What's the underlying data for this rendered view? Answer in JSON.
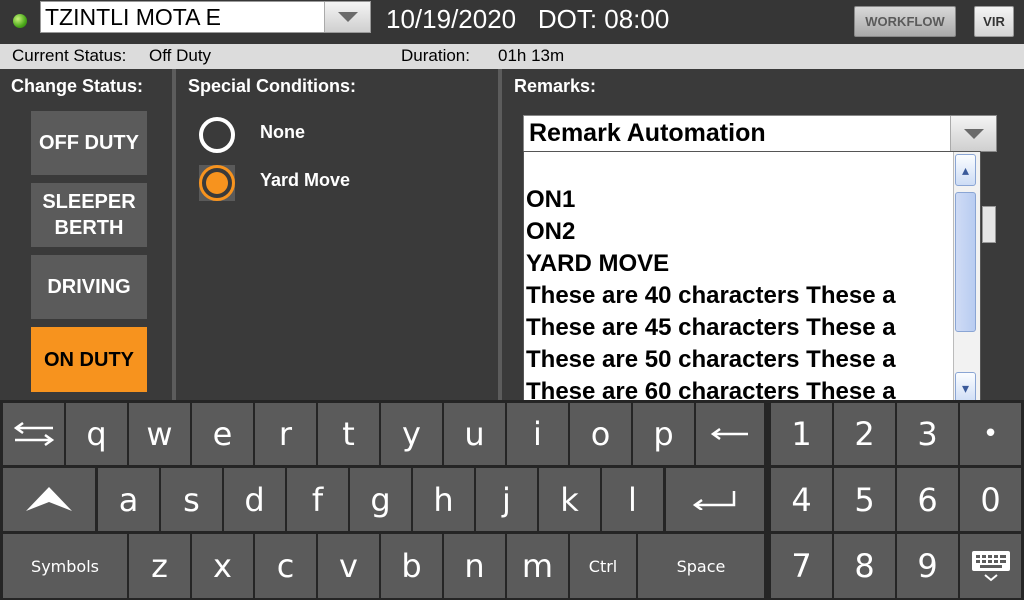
{
  "header": {
    "driver_name": "TZINTLI MOTA E",
    "date": "10/19/2020",
    "dot_label": "DOT: 08:00",
    "workflow_label": "WORKFLOW",
    "vir_label": "VIR",
    "led_color": "#4aa81a"
  },
  "status_bar": {
    "current_status_label": "Current Status:",
    "current_status_value": "Off Duty",
    "duration_label": "Duration:",
    "duration_value": "01h 13m"
  },
  "change_status": {
    "title": "Change Status:",
    "buttons": {
      "off_duty": "OFF DUTY",
      "sleeper_line1": "SLEEPER",
      "sleeper_line2": "BERTH",
      "driving": "DRIVING",
      "on_duty": "ON DUTY"
    },
    "active": "ON DUTY",
    "active_color": "#f7931e"
  },
  "special_conditions": {
    "title": "Special Conditions:",
    "options": [
      "None",
      "Yard Move"
    ],
    "selected": "Yard Move"
  },
  "remarks": {
    "title": "Remarks:",
    "selected": "Remark Automation",
    "options": [
      "",
      "ON1",
      "ON2",
      "YARD MOVE",
      "These are 40 characters These a",
      "These are 45 characters These a",
      "These are 50 characters These a",
      "These are 60 characters These a"
    ]
  },
  "keyboard": {
    "row1": [
      "q",
      "w",
      "e",
      "r",
      "t",
      "y",
      "u",
      "i",
      "o",
      "p"
    ],
    "row2": [
      "a",
      "s",
      "d",
      "f",
      "g",
      "h",
      "j",
      "k",
      "l"
    ],
    "row3": [
      "z",
      "x",
      "c",
      "v",
      "b",
      "n",
      "m"
    ],
    "symbols_label": "Symbols",
    "ctrl_label": "Ctrl",
    "space_label": "Space",
    "numpad": [
      "1",
      "2",
      "3",
      "•",
      "4",
      "5",
      "6",
      "0",
      "7",
      "8",
      "9"
    ]
  }
}
